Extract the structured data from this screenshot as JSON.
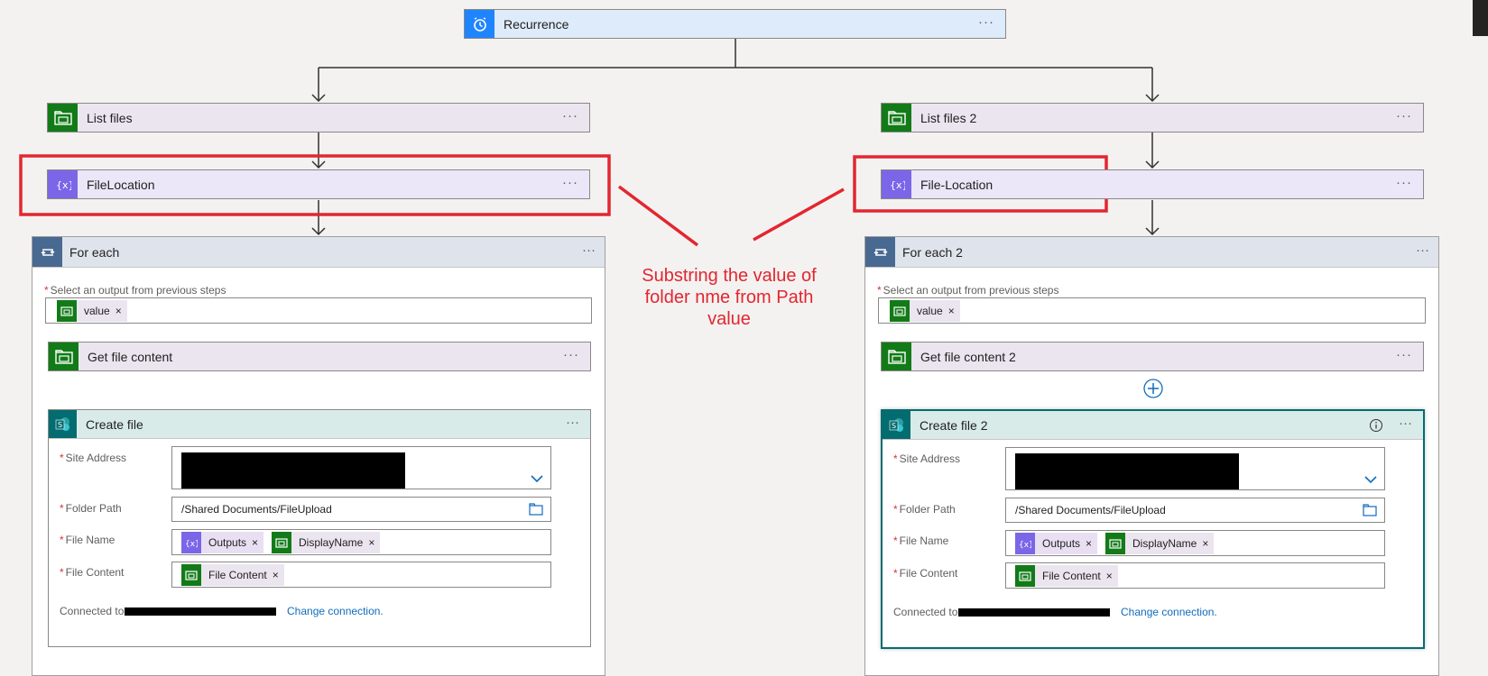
{
  "trigger": {
    "title": "Recurrence"
  },
  "left": {
    "list_files": "List files",
    "variable": "FileLocation",
    "foreach": "For each",
    "select_label": "Select an output from previous steps",
    "select_token": "value",
    "get_content": "Get file content",
    "create": "Create file",
    "site_label": "Site Address",
    "folder_label": "Folder Path",
    "folder_value": "/Shared Documents/FileUpload",
    "name_label": "File Name",
    "name_tokens": [
      "Outputs",
      "DisplayName"
    ],
    "content_label": "File Content",
    "content_token": "File Content",
    "connected": "Connected to",
    "change": "Change connection."
  },
  "right": {
    "list_files": "List files 2",
    "variable": "File-Location",
    "foreach": "For each 2",
    "select_label": "Select an output from previous steps",
    "select_token": "value",
    "get_content": "Get file content 2",
    "create": "Create file 2",
    "site_label": "Site Address",
    "folder_label": "Folder Path",
    "folder_value": "/Shared Documents/FileUpload",
    "name_label": "File Name",
    "name_tokens": [
      "Outputs",
      "DisplayName"
    ],
    "content_label": "File Content",
    "content_token": "File Content",
    "connected": "Connected to",
    "change": "Change connection."
  },
  "annotation": {
    "line1": "Substring the value of",
    "line2": "folder nme from Path",
    "line3": "value"
  },
  "menu_glyph": "···",
  "remove_glyph": "×",
  "colors": {
    "highlight_red": "#e3262f",
    "sharepoint_green": "#127b18",
    "variable_purple": "#7b66e8",
    "recurrence_blue": "#1f85ff",
    "loop_slate": "#486991",
    "sharepoint_teal": "#036c70"
  }
}
